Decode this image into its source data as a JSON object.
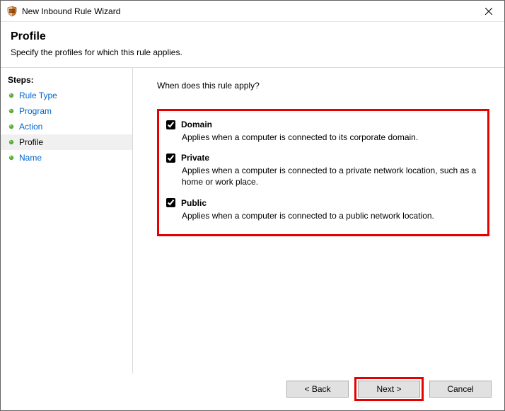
{
  "window": {
    "title": "New Inbound Rule Wizard"
  },
  "header": {
    "title": "Profile",
    "subtitle": "Specify the profiles for which this rule applies."
  },
  "sidebar": {
    "label": "Steps:",
    "items": [
      {
        "label": "Rule Type",
        "current": false
      },
      {
        "label": "Program",
        "current": false
      },
      {
        "label": "Action",
        "current": false
      },
      {
        "label": "Profile",
        "current": true
      },
      {
        "label": "Name",
        "current": false
      }
    ]
  },
  "content": {
    "question": "When does this rule apply?",
    "options": [
      {
        "name": "Domain",
        "checked": true,
        "desc": "Applies when a computer is connected to its corporate domain."
      },
      {
        "name": "Private",
        "checked": true,
        "desc": "Applies when a computer is connected to a private network location, such as a home or work place."
      },
      {
        "name": "Public",
        "checked": true,
        "desc": "Applies when a computer is connected to a public network location."
      }
    ]
  },
  "footer": {
    "back": "< Back",
    "next": "Next >",
    "cancel": "Cancel"
  }
}
